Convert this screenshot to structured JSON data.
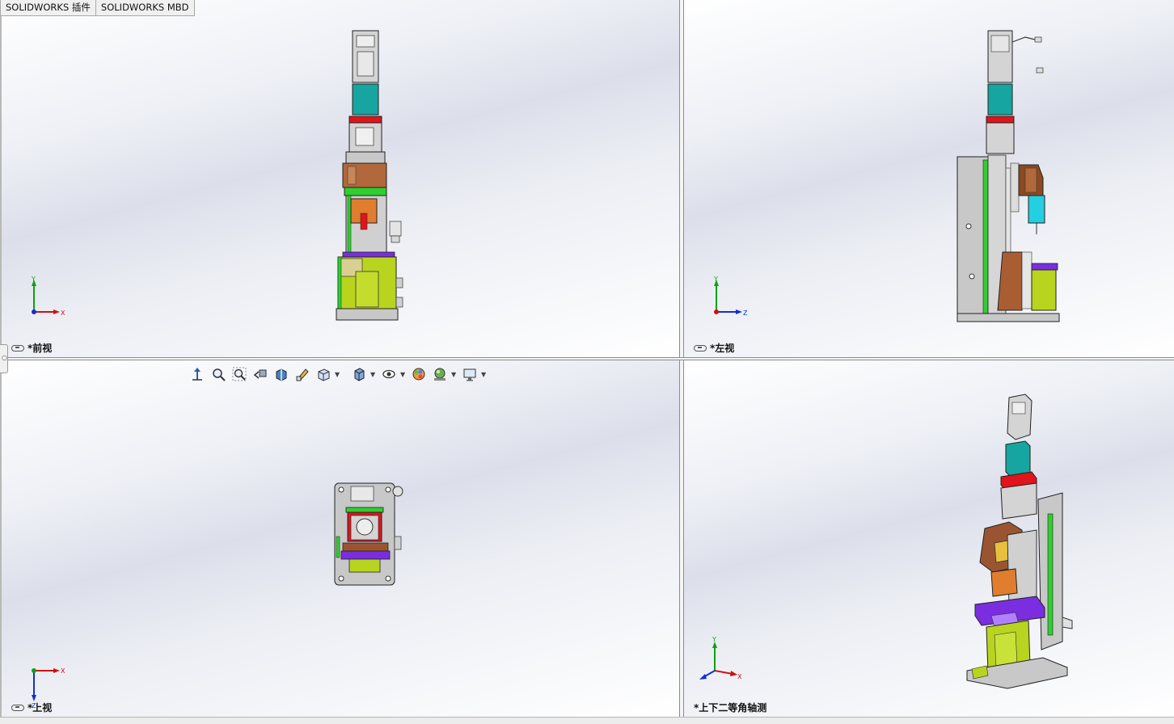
{
  "tabs": [
    "SOLIDWORKS 插件",
    "SOLIDWORKS MBD"
  ],
  "views": {
    "front": {
      "label": "*前视",
      "axes": [
        "Y",
        "X"
      ]
    },
    "left": {
      "label": "*左视",
      "axes": [
        "Y",
        "Z"
      ]
    },
    "top": {
      "label": "*上视",
      "axes": [
        "X",
        "Z"
      ]
    },
    "iso": {
      "label": "*上下二等角轴测",
      "axes": [
        "Y",
        "X"
      ]
    }
  },
  "heads_up_toolbar": {
    "icons": [
      "view-orientation-icon",
      "zoom-to-fit-icon",
      "zoom-to-area-icon",
      "previous-view-icon",
      "section-view-icon",
      "dynamic-annotation-icon",
      "view-orientation-cube-icon",
      "display-style-icon",
      "hide-show-items-icon",
      "edit-appearance-icon",
      "apply-scene-icon",
      "view-settings-icon"
    ]
  },
  "colors": {
    "viewport_mid": "#dcdfea",
    "triad_x": "#d01010",
    "triad_y": "#10a010",
    "triad_z": "#1030d0",
    "teal": "#16a5a0",
    "red": "#e0141a",
    "copper": "#b0683c",
    "orange": "#e07d2e",
    "purple": "#7a2ee0",
    "lime": "#b9d41e",
    "green": "#2fcf2f",
    "cyan": "#23cfe0",
    "gray": "#c8c8c8"
  }
}
